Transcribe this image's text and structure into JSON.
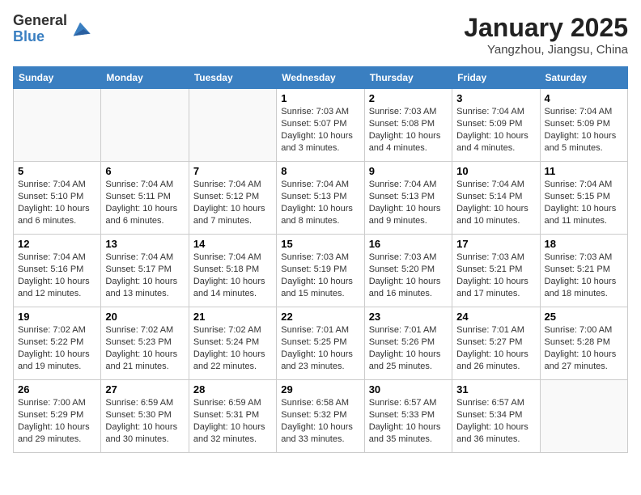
{
  "header": {
    "logo_general": "General",
    "logo_blue": "Blue",
    "month_title": "January 2025",
    "location": "Yangzhou, Jiangsu, China"
  },
  "days_of_week": [
    "Sunday",
    "Monday",
    "Tuesday",
    "Wednesday",
    "Thursday",
    "Friday",
    "Saturday"
  ],
  "weeks": [
    [
      {
        "num": "",
        "info": ""
      },
      {
        "num": "",
        "info": ""
      },
      {
        "num": "",
        "info": ""
      },
      {
        "num": "1",
        "info": "Sunrise: 7:03 AM\nSunset: 5:07 PM\nDaylight: 10 hours and 3 minutes."
      },
      {
        "num": "2",
        "info": "Sunrise: 7:03 AM\nSunset: 5:08 PM\nDaylight: 10 hours and 4 minutes."
      },
      {
        "num": "3",
        "info": "Sunrise: 7:04 AM\nSunset: 5:09 PM\nDaylight: 10 hours and 4 minutes."
      },
      {
        "num": "4",
        "info": "Sunrise: 7:04 AM\nSunset: 5:09 PM\nDaylight: 10 hours and 5 minutes."
      }
    ],
    [
      {
        "num": "5",
        "info": "Sunrise: 7:04 AM\nSunset: 5:10 PM\nDaylight: 10 hours and 6 minutes."
      },
      {
        "num": "6",
        "info": "Sunrise: 7:04 AM\nSunset: 5:11 PM\nDaylight: 10 hours and 6 minutes."
      },
      {
        "num": "7",
        "info": "Sunrise: 7:04 AM\nSunset: 5:12 PM\nDaylight: 10 hours and 7 minutes."
      },
      {
        "num": "8",
        "info": "Sunrise: 7:04 AM\nSunset: 5:13 PM\nDaylight: 10 hours and 8 minutes."
      },
      {
        "num": "9",
        "info": "Sunrise: 7:04 AM\nSunset: 5:13 PM\nDaylight: 10 hours and 9 minutes."
      },
      {
        "num": "10",
        "info": "Sunrise: 7:04 AM\nSunset: 5:14 PM\nDaylight: 10 hours and 10 minutes."
      },
      {
        "num": "11",
        "info": "Sunrise: 7:04 AM\nSunset: 5:15 PM\nDaylight: 10 hours and 11 minutes."
      }
    ],
    [
      {
        "num": "12",
        "info": "Sunrise: 7:04 AM\nSunset: 5:16 PM\nDaylight: 10 hours and 12 minutes."
      },
      {
        "num": "13",
        "info": "Sunrise: 7:04 AM\nSunset: 5:17 PM\nDaylight: 10 hours and 13 minutes."
      },
      {
        "num": "14",
        "info": "Sunrise: 7:04 AM\nSunset: 5:18 PM\nDaylight: 10 hours and 14 minutes."
      },
      {
        "num": "15",
        "info": "Sunrise: 7:03 AM\nSunset: 5:19 PM\nDaylight: 10 hours and 15 minutes."
      },
      {
        "num": "16",
        "info": "Sunrise: 7:03 AM\nSunset: 5:20 PM\nDaylight: 10 hours and 16 minutes."
      },
      {
        "num": "17",
        "info": "Sunrise: 7:03 AM\nSunset: 5:21 PM\nDaylight: 10 hours and 17 minutes."
      },
      {
        "num": "18",
        "info": "Sunrise: 7:03 AM\nSunset: 5:21 PM\nDaylight: 10 hours and 18 minutes."
      }
    ],
    [
      {
        "num": "19",
        "info": "Sunrise: 7:02 AM\nSunset: 5:22 PM\nDaylight: 10 hours and 19 minutes."
      },
      {
        "num": "20",
        "info": "Sunrise: 7:02 AM\nSunset: 5:23 PM\nDaylight: 10 hours and 21 minutes."
      },
      {
        "num": "21",
        "info": "Sunrise: 7:02 AM\nSunset: 5:24 PM\nDaylight: 10 hours and 22 minutes."
      },
      {
        "num": "22",
        "info": "Sunrise: 7:01 AM\nSunset: 5:25 PM\nDaylight: 10 hours and 23 minutes."
      },
      {
        "num": "23",
        "info": "Sunrise: 7:01 AM\nSunset: 5:26 PM\nDaylight: 10 hours and 25 minutes."
      },
      {
        "num": "24",
        "info": "Sunrise: 7:01 AM\nSunset: 5:27 PM\nDaylight: 10 hours and 26 minutes."
      },
      {
        "num": "25",
        "info": "Sunrise: 7:00 AM\nSunset: 5:28 PM\nDaylight: 10 hours and 27 minutes."
      }
    ],
    [
      {
        "num": "26",
        "info": "Sunrise: 7:00 AM\nSunset: 5:29 PM\nDaylight: 10 hours and 29 minutes."
      },
      {
        "num": "27",
        "info": "Sunrise: 6:59 AM\nSunset: 5:30 PM\nDaylight: 10 hours and 30 minutes."
      },
      {
        "num": "28",
        "info": "Sunrise: 6:59 AM\nSunset: 5:31 PM\nDaylight: 10 hours and 32 minutes."
      },
      {
        "num": "29",
        "info": "Sunrise: 6:58 AM\nSunset: 5:32 PM\nDaylight: 10 hours and 33 minutes."
      },
      {
        "num": "30",
        "info": "Sunrise: 6:57 AM\nSunset: 5:33 PM\nDaylight: 10 hours and 35 minutes."
      },
      {
        "num": "31",
        "info": "Sunrise: 6:57 AM\nSunset: 5:34 PM\nDaylight: 10 hours and 36 minutes."
      },
      {
        "num": "",
        "info": ""
      }
    ]
  ]
}
